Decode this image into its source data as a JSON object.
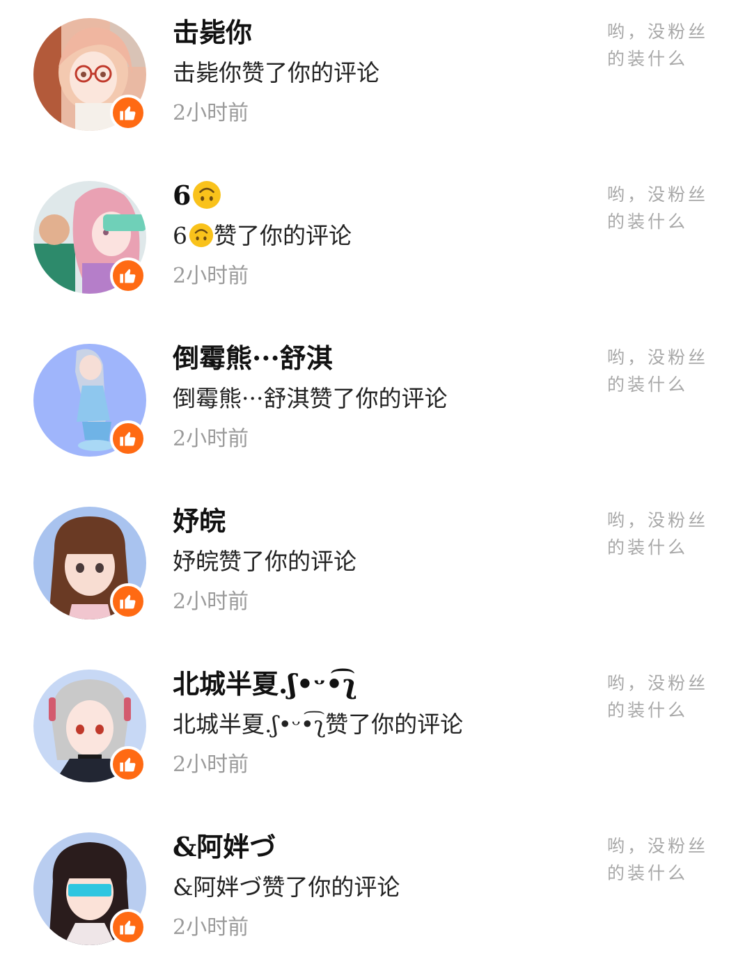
{
  "notifications": [
    {
      "name": "击毙你",
      "action": "击毙你赞了你的评论",
      "time": "2小时前",
      "quote_line1": "哟，没粉丝",
      "quote_line2": "的装什么"
    },
    {
      "name": "6",
      "name_emoji": "upside-down-face-emoji",
      "action_prefix": "6",
      "action_suffix": "赞了你的评论",
      "time": "2小时前",
      "quote_line1": "哟，没粉丝",
      "quote_line2": "的装什么"
    },
    {
      "name": "倒霉熊···舒淇",
      "action": "倒霉熊···舒淇赞了你的评论",
      "time": "2小时前",
      "quote_line1": "哟，没粉丝",
      "quote_line2": "的装什么"
    },
    {
      "name": "妤皖",
      "action": "妤皖赞了你的评论",
      "time": "2小时前",
      "quote_line1": "哟，没粉丝",
      "quote_line2": "的装什么"
    },
    {
      "name": "北城半夏.ʃ•ᵕ•͡ʅ",
      "action": "北城半夏.ʃ•ᵕ•͡ʅ赞了你的评论",
      "time": "2小时前",
      "quote_line1": "哟，没粉丝",
      "quote_line2": "的装什么"
    },
    {
      "name": "&阿姅づ",
      "action": "&阿姅づ赞了你的评论",
      "time": "2小时前",
      "quote_line1": "哟，没粉丝",
      "quote_line2": "的装什么"
    }
  ],
  "icons": {
    "like_badge": "thumbs-up-icon",
    "avatar": "avatar-image"
  },
  "colors": {
    "like_badge": "#ff6a13",
    "name_text": "#111111",
    "time_text": "#9a9a9a",
    "quote_text": "#a8a8a8"
  }
}
